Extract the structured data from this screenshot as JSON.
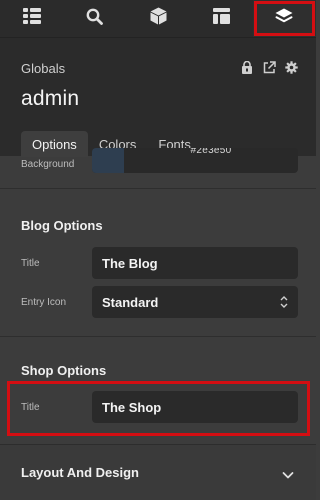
{
  "topbar": {
    "buttons": [
      {
        "icon": "list-icon"
      },
      {
        "icon": "search-icon"
      },
      {
        "icon": "cube-icon"
      },
      {
        "icon": "layout-icon"
      },
      {
        "icon": "layers-icon",
        "active": true
      }
    ]
  },
  "header": {
    "breadcrumb": "Globals",
    "title": "admin",
    "actions": [
      "lock-icon",
      "export-icon",
      "gear-icon"
    ]
  },
  "tabs": [
    {
      "label": "Options",
      "active": true
    },
    {
      "label": "Colors"
    },
    {
      "label": "Fonts"
    }
  ],
  "background_row": {
    "label": "Background",
    "value": "#2e3e50",
    "visible_text": "#2e3e50"
  },
  "blog_options": {
    "section_title": "Blog Options",
    "title_label": "Title",
    "title_value": "The Blog",
    "entry_icon_label": "Entry Icon",
    "entry_icon_value": "Standard"
  },
  "shop_options": {
    "section_title": "Shop Options",
    "title_label": "Title",
    "title_value": "The Shop"
  },
  "accordion": {
    "label": "Layout And Design"
  },
  "colors": {
    "highlight": "#d40e12",
    "panel": "#2b2b2b",
    "content_bg": "#3c3c3c",
    "field_bg": "#2a2a2a"
  }
}
